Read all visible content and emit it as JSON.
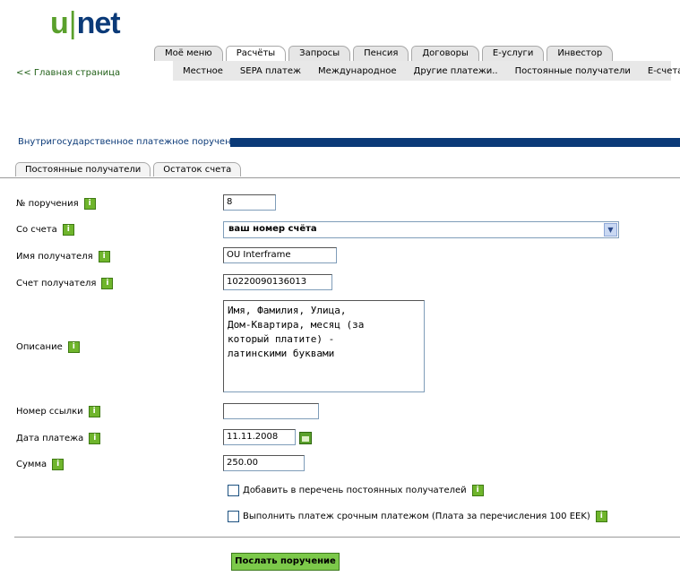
{
  "logo": {
    "u": "u",
    "sep": "|",
    "net": "net"
  },
  "top_tabs": [
    "Моё меню",
    "Расчёты",
    "Запросы",
    "Пенсия",
    "Договоры",
    "E-услуги",
    "Инвестор"
  ],
  "sub_nav": [
    "Местное",
    "SEPA платеж",
    "Международное",
    "Другие платежи..",
    "Постоянные получатели",
    "E-счета.."
  ],
  "home_link": "<< Главная страница",
  "section_title": "Внутригосударственное платежное поручение",
  "sub_tabs": [
    "Постоянные получатели",
    "Остаток счета"
  ],
  "form": {
    "order_no": {
      "label": "№ поручения",
      "value": "8"
    },
    "from_account": {
      "label": "Со счета",
      "value": "ваш номер счёта"
    },
    "recipient_name": {
      "label": "Имя получателя",
      "value": "OU Interframe"
    },
    "recipient_account": {
      "label": "Счет получателя",
      "value": "10220090136013"
    },
    "description": {
      "label": "Описание",
      "value": "Имя, Фамилия, Улица,\nДом-Квартира, месяц (за\nкоторый платите) -\nлатинскими буквами"
    },
    "reference": {
      "label": "Номер ссылки",
      "value": ""
    },
    "date": {
      "label": "Дата платежа",
      "value": "11.11.2008"
    },
    "amount": {
      "label": "Сумма",
      "value": "250.00"
    }
  },
  "checkboxes": {
    "add_recipient": "Добавить в перечень постоянных получателей",
    "urgent": "Выполнить платеж срочным платежом (Плата за перечисления 100 EEK)"
  },
  "submit_label": "Послать поручение",
  "info_glyph": "i",
  "colors": {
    "brand_green": "#5aa02c",
    "brand_blue": "#0b3a78",
    "button_green": "#7cc94a"
  }
}
